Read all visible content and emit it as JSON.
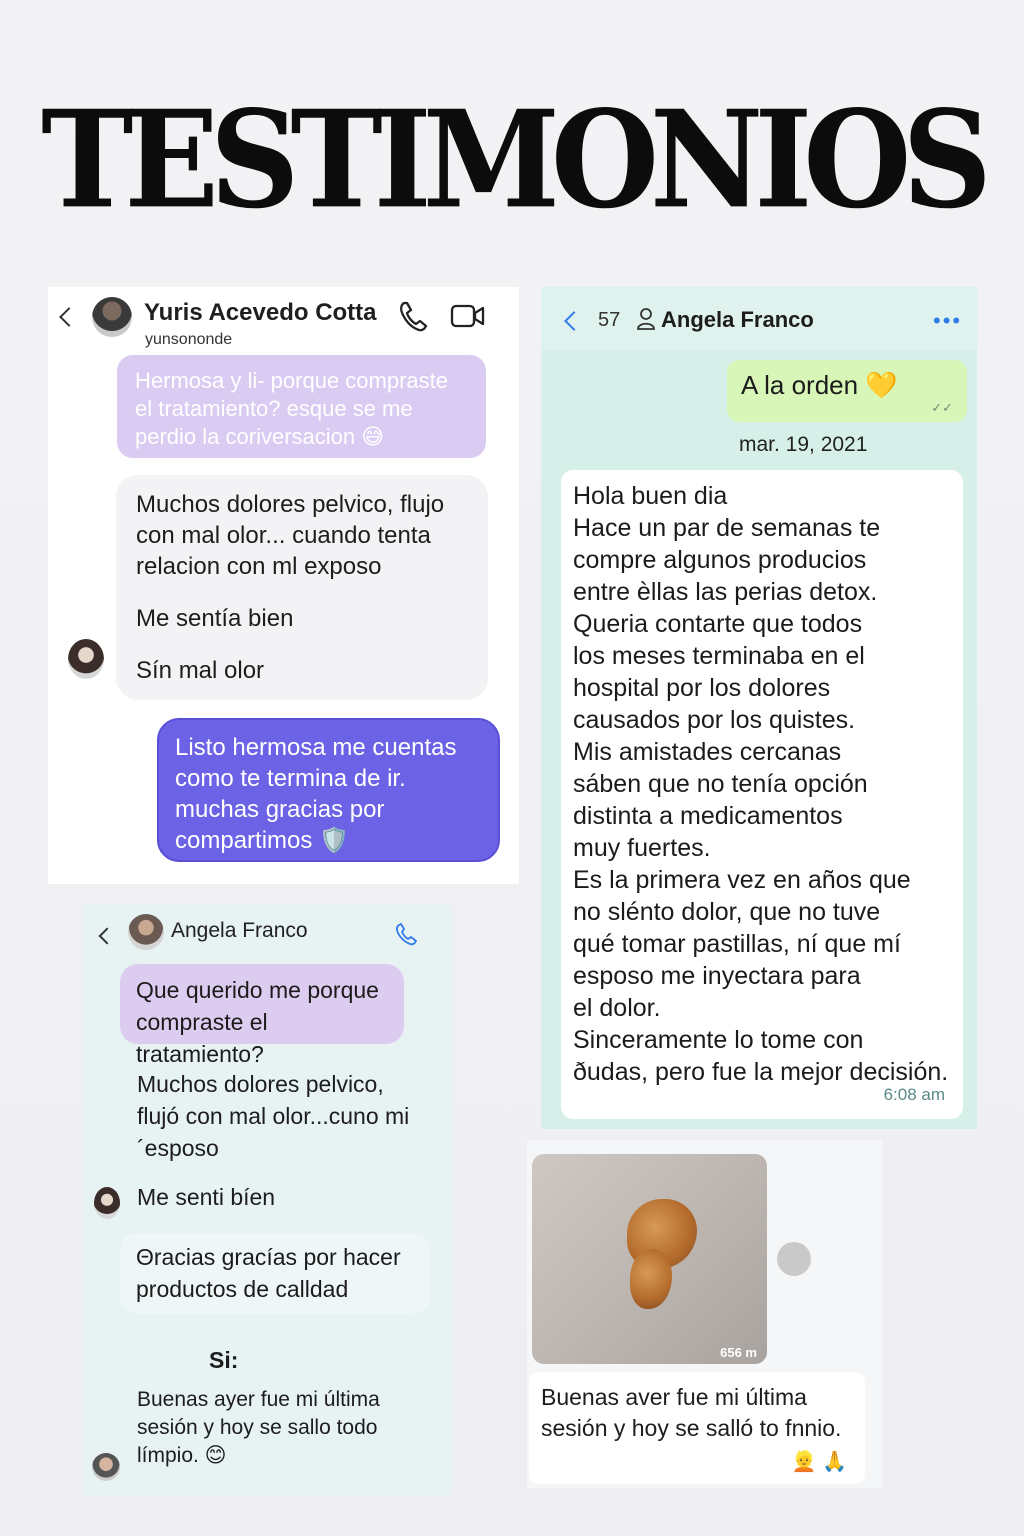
{
  "page": {
    "title": "TESTIMONIOS"
  },
  "card1": {
    "contact_name": "Yuris Acevedo Cotta",
    "contact_handle": "yunsononde",
    "msg_question": "Hermosa y li- porque compraste el tratamiento? esque se me perdio la coriversacion 😅",
    "msg_reply_1": "Muchos dolores pelvico, flujo con mal olor... cuando tenta relacion con ml exposo",
    "msg_reply_2": "Me sentía bien",
    "msg_reply_3": "Sín mal olor",
    "msg_thanks": "Listo hermosa me cuentas como te termina de ir. muchas gracias por compartimos 🛡️"
  },
  "card2": {
    "unread_count": "57",
    "contact_name": "Angela Franco",
    "more_label": "•••",
    "msg_sent": "A la orden 💛",
    "msg_sent_ticks": "✓✓",
    "date": "mar. 19, 2021",
    "msg_lines": [
      "Hola buen dia",
      "Hace un par de semanas te",
      "compre algunos producios",
      "entre èllas las perias detox.",
      "Queria contarte que todos",
      "los meses terminaba en el",
      "hospital por los dolores",
      "causados por los quistes.",
      "Mis amistades cercanas",
      "sáben que no tenía opción",
      "distinta a medicamentos",
      "muy fuertes.",
      "Es la primera vez en años que",
      "no slénto dolor, que no tuve",
      "qué tomar pastillas, ní que mí",
      "esposo me inyectara para",
      "el dolor.",
      "Sinceramente lo tome con",
      "ðudas, pero fue la mejor decisión."
    ],
    "time": "6:08 am"
  },
  "card3": {
    "contact_name": "Angela Franco",
    "msg_question": "Que querido me porque compraste el tratamiento?",
    "msg_reply_1": "Muchos dolores pelvico, flujó con mal olor...cuno mi´esposo",
    "msg_reply_2": "Me senti bíen",
    "msg_reply_3": "Θracias gracías por hacer productos de calldad",
    "msg_si": "Si:",
    "msg_final": "Buenas ayer fue mi última sesión y hoy se sallo todo límpio. 😊"
  },
  "card4": {
    "photo_tag": "656 m",
    "caption": "Buenas aver fue mi última sesión y hoy se salló to fnnio.",
    "reactions": "👱 🙏"
  },
  "colors": {
    "accent_blue": "#2f7be8",
    "bubble_purple": "#6b62e6",
    "bubble_lilac": "#d9cbf2",
    "wa_green": "#d8f6b8"
  },
  "icons": [
    "back-chevron-icon",
    "phone-icon",
    "video-camera-icon",
    "person-icon",
    "share-icon"
  ]
}
